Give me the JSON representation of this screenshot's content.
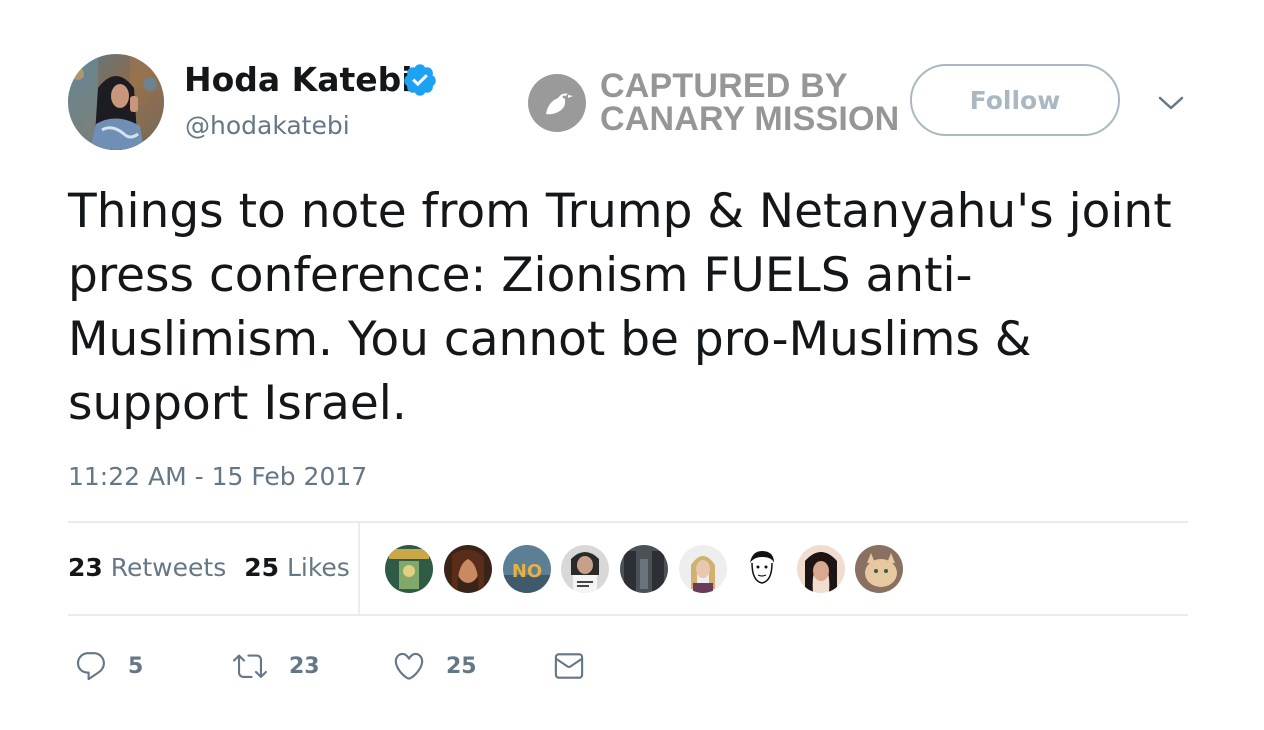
{
  "tweet": {
    "author": {
      "name": "Hoda Katebi",
      "handle": "@hodakatebi",
      "verified": true,
      "avatar_icon": "avatar"
    },
    "watermark": {
      "line1": "CAPTURED BY",
      "line2": "CANARY MISSION",
      "icon": "canary-bird-icon"
    },
    "follow_label": "Follow",
    "text": "Things to note from Trump & Netanyahu's joint press conference: Zionism FUELS anti-Muslimism. You cannot be pro-Muslims & support Israel.",
    "timestamp": "11:22 AM - 15 Feb 2017",
    "stats": {
      "retweets_count": "23",
      "retweets_label": "Retweets",
      "likes_count": "25",
      "likes_label": "Likes"
    },
    "liker_avatars": 9,
    "actions": {
      "reply_count": "5",
      "retweet_count": "23",
      "like_count": "25"
    }
  },
  "colors": {
    "text_primary": "#14171a",
    "text_secondary": "#657786",
    "follow_border": "#aab8c2",
    "verified_blue": "#1da1f2",
    "divider": "#e6ecf0",
    "watermark_gray": "#969696"
  }
}
